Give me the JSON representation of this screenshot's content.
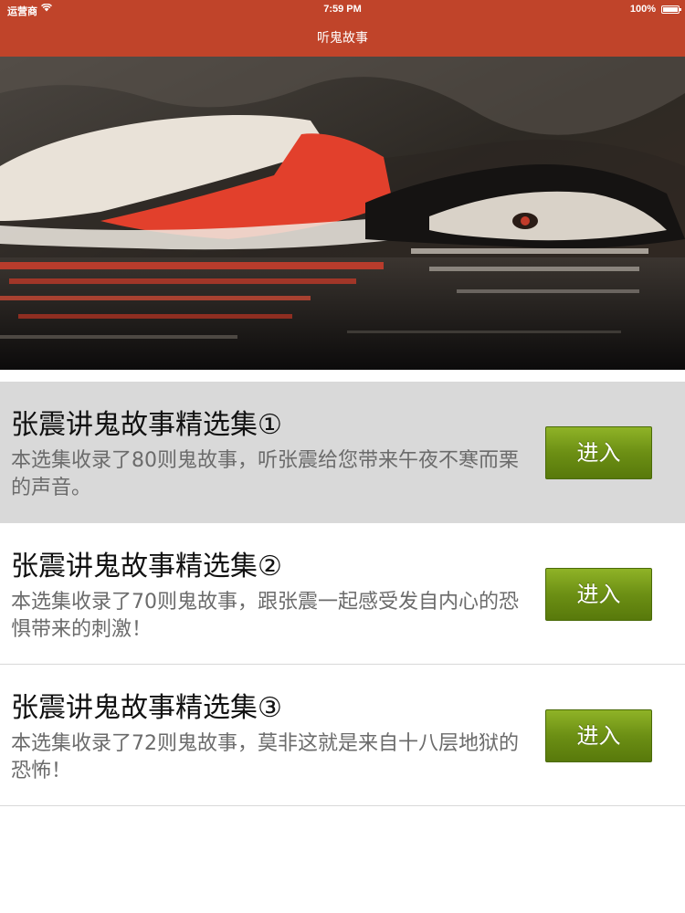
{
  "status_bar": {
    "carrier": "运营商",
    "time": "7:59 PM",
    "battery": "100%"
  },
  "nav": {
    "title": "听鬼故事"
  },
  "hero": {
    "image": "woman-in-water-photo"
  },
  "collections": [
    {
      "title": "张震讲鬼故事精选集①",
      "description": "本选集收录了80则鬼故事，听张震给您带来午夜不寒而栗的声音。",
      "button": "进入",
      "selected": true
    },
    {
      "title": "张震讲鬼故事精选集②",
      "description": "本选集收录了70则鬼故事，跟张震一起感受发自内心的恐惧带来的刺激！",
      "button": "进入",
      "selected": false
    },
    {
      "title": "张震讲鬼故事精选集③",
      "description": "本选集收录了72则鬼故事，莫非这就是来自十八层地狱的恐怖！",
      "button": "进入",
      "selected": false
    }
  ],
  "colors": {
    "nav_background": "#c0442a",
    "button_green": "#6c8f14",
    "selected_row": "#d9d9d9"
  }
}
